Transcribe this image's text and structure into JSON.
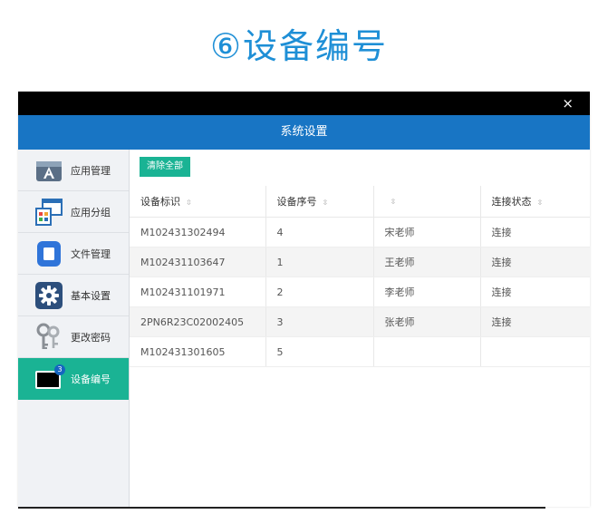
{
  "heading": "⑥设备编号",
  "window": {
    "title": "系统设置",
    "close_glyph": "×"
  },
  "sidebar": {
    "items": [
      {
        "label": "应用管理",
        "icon": "app-store-icon"
      },
      {
        "label": "应用分组",
        "icon": "app-group-icon"
      },
      {
        "label": "文件管理",
        "icon": "file-manager-icon"
      },
      {
        "label": "基本设置",
        "icon": "gear-icon"
      },
      {
        "label": "更改密码",
        "icon": "keys-icon"
      },
      {
        "label": "设备编号",
        "icon": "tablet-icon",
        "badge": "3",
        "active": true
      }
    ]
  },
  "toolbar": {
    "clear_all": "清除全部"
  },
  "table": {
    "sort_glyph": "⇳",
    "headers": [
      "设备标识",
      "设备序号",
      "",
      "连接状态"
    ],
    "rows": [
      [
        "M102431302494",
        "4",
        "宋老师",
        "连接"
      ],
      [
        "M102431103647",
        "1",
        "王老师",
        "连接"
      ],
      [
        "M102431101971",
        "2",
        "李老师",
        "连接"
      ],
      [
        "2PN6R23C02002405",
        "3",
        "张老师",
        "连接"
      ],
      [
        "M102431301605",
        "5",
        "",
        ""
      ]
    ]
  },
  "colors": {
    "accent_teal": "#1ab394",
    "title_blue": "#1875c4",
    "heading_blue": "#1e8fd6"
  }
}
